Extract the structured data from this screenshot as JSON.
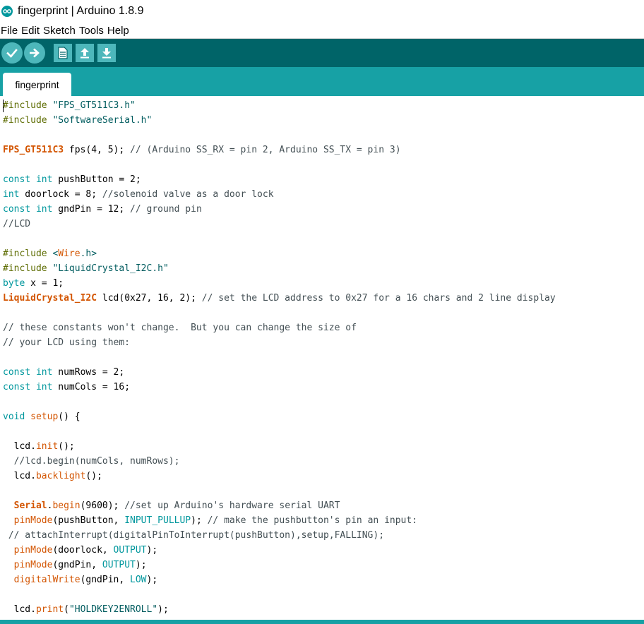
{
  "window": {
    "title": "fingerprint | Arduino 1.8.9"
  },
  "menu": [
    "File",
    "Edit",
    "Sketch",
    "Tools",
    "Help"
  ],
  "toolbar": {
    "icons": [
      "verify-icon",
      "upload-icon",
      "new-icon",
      "open-icon",
      "save-icon"
    ],
    "colors": {
      "bar": "#006468",
      "button": "#4db7bb",
      "tabbar": "#17a1a5"
    }
  },
  "tabs": [
    {
      "label": "fingerprint"
    }
  ],
  "code": [
    [
      [
        "pp",
        "#include"
      ],
      [
        "",
        " "
      ],
      [
        "str",
        "\"FPS_GT511C3.h\""
      ]
    ],
    [
      [
        "pp",
        "#include"
      ],
      [
        "",
        " "
      ],
      [
        "str",
        "\"SoftwareSerial.h\""
      ]
    ],
    [],
    [
      [
        "cls",
        "FPS_GT511C3"
      ],
      [
        "",
        " fps(4, 5); "
      ],
      [
        "cm",
        "// (Arduino SS_RX = pin 2, Arduino SS_TX = pin 3)"
      ]
    ],
    [],
    [
      [
        "ty",
        "const"
      ],
      [
        "",
        " "
      ],
      [
        "ty",
        "int"
      ],
      [
        "",
        " pushButton = 2;"
      ]
    ],
    [
      [
        "ty",
        "int"
      ],
      [
        "",
        " doorlock = 8; "
      ],
      [
        "cm",
        "//solenoid valve as a door lock"
      ]
    ],
    [
      [
        "ty",
        "const"
      ],
      [
        "",
        " "
      ],
      [
        "ty",
        "int"
      ],
      [
        "",
        " gndPin = 12; "
      ],
      [
        "cm",
        "// ground pin"
      ]
    ],
    [
      [
        "cm",
        "//LCD"
      ]
    ],
    [],
    [
      [
        "pp",
        "#include"
      ],
      [
        "",
        " "
      ],
      [
        "str",
        "<"
      ],
      [
        "fn",
        "Wire"
      ],
      [
        "str",
        ".h>"
      ]
    ],
    [
      [
        "pp",
        "#include"
      ],
      [
        "",
        " "
      ],
      [
        "str",
        "\"LiquidCrystal_I2C.h\""
      ]
    ],
    [
      [
        "ty",
        "byte"
      ],
      [
        "",
        " x = 1;"
      ]
    ],
    [
      [
        "cls",
        "LiquidCrystal_I2C"
      ],
      [
        "",
        " lcd(0x27, 16, 2); "
      ],
      [
        "cm",
        "// set the LCD address to 0x27 for a 16 chars and 2 line display"
      ]
    ],
    [],
    [
      [
        "cm",
        "// these constants won't change.  But you can change the size of"
      ]
    ],
    [
      [
        "cm",
        "// your LCD using them:"
      ]
    ],
    [],
    [
      [
        "ty",
        "const"
      ],
      [
        "",
        " "
      ],
      [
        "ty",
        "int"
      ],
      [
        "",
        " numRows = 2;"
      ]
    ],
    [
      [
        "ty",
        "const"
      ],
      [
        "",
        " "
      ],
      [
        "ty",
        "int"
      ],
      [
        "",
        " numCols = 16;"
      ]
    ],
    [],
    [
      [
        "ty",
        "void"
      ],
      [
        "",
        " "
      ],
      [
        "fn",
        "setup"
      ],
      [
        "",
        "() {"
      ]
    ],
    [],
    [
      [
        "",
        "  lcd."
      ],
      [
        "fn",
        "init"
      ],
      [
        "",
        "();"
      ]
    ],
    [
      [
        "cm",
        "  //lcd.begin(numCols, numRows);"
      ]
    ],
    [
      [
        "",
        "  lcd."
      ],
      [
        "fn",
        "backlight"
      ],
      [
        "",
        "();"
      ]
    ],
    [],
    [
      [
        "",
        "  "
      ],
      [
        "cls",
        "Serial"
      ],
      [
        "",
        "."
      ],
      [
        "fn",
        "begin"
      ],
      [
        "",
        "(9600); "
      ],
      [
        "cm",
        "//set up Arduino's hardware serial UART"
      ]
    ],
    [
      [
        "",
        "  "
      ],
      [
        "fn",
        "pinMode"
      ],
      [
        "",
        "(pushButton, "
      ],
      [
        "cst",
        "INPUT_PULLUP"
      ],
      [
        "",
        "); "
      ],
      [
        "cm",
        "// make the pushbutton's pin an input:"
      ]
    ],
    [
      [
        "cm",
        " // attachInterrupt(digitalPinToInterrupt(pushButton),setup,FALLING);"
      ]
    ],
    [
      [
        "",
        "  "
      ],
      [
        "fn",
        "pinMode"
      ],
      [
        "",
        "(doorlock, "
      ],
      [
        "cst",
        "OUTPUT"
      ],
      [
        "",
        ");"
      ]
    ],
    [
      [
        "",
        "  "
      ],
      [
        "fn",
        "pinMode"
      ],
      [
        "",
        "(gndPin, "
      ],
      [
        "cst",
        "OUTPUT"
      ],
      [
        "",
        ");"
      ]
    ],
    [
      [
        "",
        "  "
      ],
      [
        "fn",
        "digitalWrite"
      ],
      [
        "",
        "(gndPin, "
      ],
      [
        "cst",
        "LOW"
      ],
      [
        "",
        ");"
      ]
    ],
    [],
    [
      [
        "",
        "  lcd."
      ],
      [
        "fn",
        "print"
      ],
      [
        "",
        "("
      ],
      [
        "str",
        "\"HOLDKEY2ENROLL\""
      ],
      [
        "",
        ");"
      ]
    ]
  ]
}
